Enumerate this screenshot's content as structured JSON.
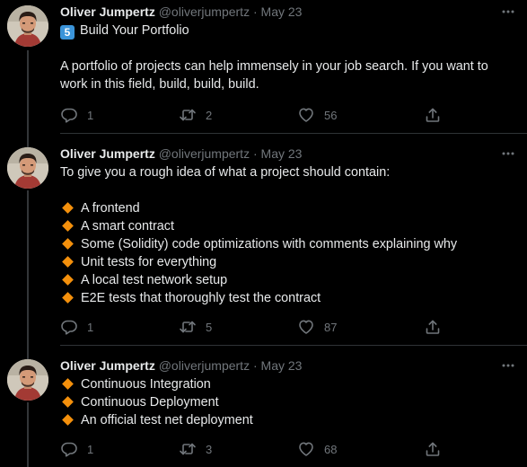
{
  "tweets": [
    {
      "author_name": "Oliver Jumpertz",
      "handle": "@oliverjumpertz",
      "separator": "·",
      "date": "May 23",
      "keycap": "5",
      "heading": "Build Your Portfolio",
      "text_lines": [
        "A portfolio of projects can help immensely in your job search. If you want to",
        "work in this field, build, build, build."
      ],
      "replies": "1",
      "retweets": "2",
      "likes": "56"
    },
    {
      "author_name": "Oliver Jumpertz",
      "handle": "@oliverjumpertz",
      "separator": "·",
      "date": "May 23",
      "intro": "To give you a rough idea of what a project should contain:",
      "bullets": [
        "A frontend",
        "A smart contract",
        "Some (Solidity) code optimizations with comments explaining why",
        "Unit tests for everything",
        "A local test network setup",
        "E2E tests that thoroughly test the contract"
      ],
      "replies": "1",
      "retweets": "5",
      "likes": "87"
    },
    {
      "author_name": "Oliver Jumpertz",
      "handle": "@oliverjumpertz",
      "separator": "·",
      "date": "May 23",
      "bullets": [
        "Continuous Integration",
        "Continuous Deployment",
        "An official test net deployment"
      ],
      "replies": "1",
      "retweets": "3",
      "likes": "68"
    }
  ],
  "icons": {
    "more": "more-options-icon",
    "reply": "reply-icon",
    "retweet": "retweet-icon",
    "like": "like-heart-icon",
    "share": "share-icon",
    "bullet": "orange-diamond-icon",
    "keycap": "keycap-number-icon"
  },
  "colors": {
    "background": "#000000",
    "text_primary": "#e7e9ea",
    "text_secondary": "#71767b",
    "divider": "#2f3336",
    "bullet_orange": "#f4900c",
    "keycap_blue": "#3b94d9"
  }
}
